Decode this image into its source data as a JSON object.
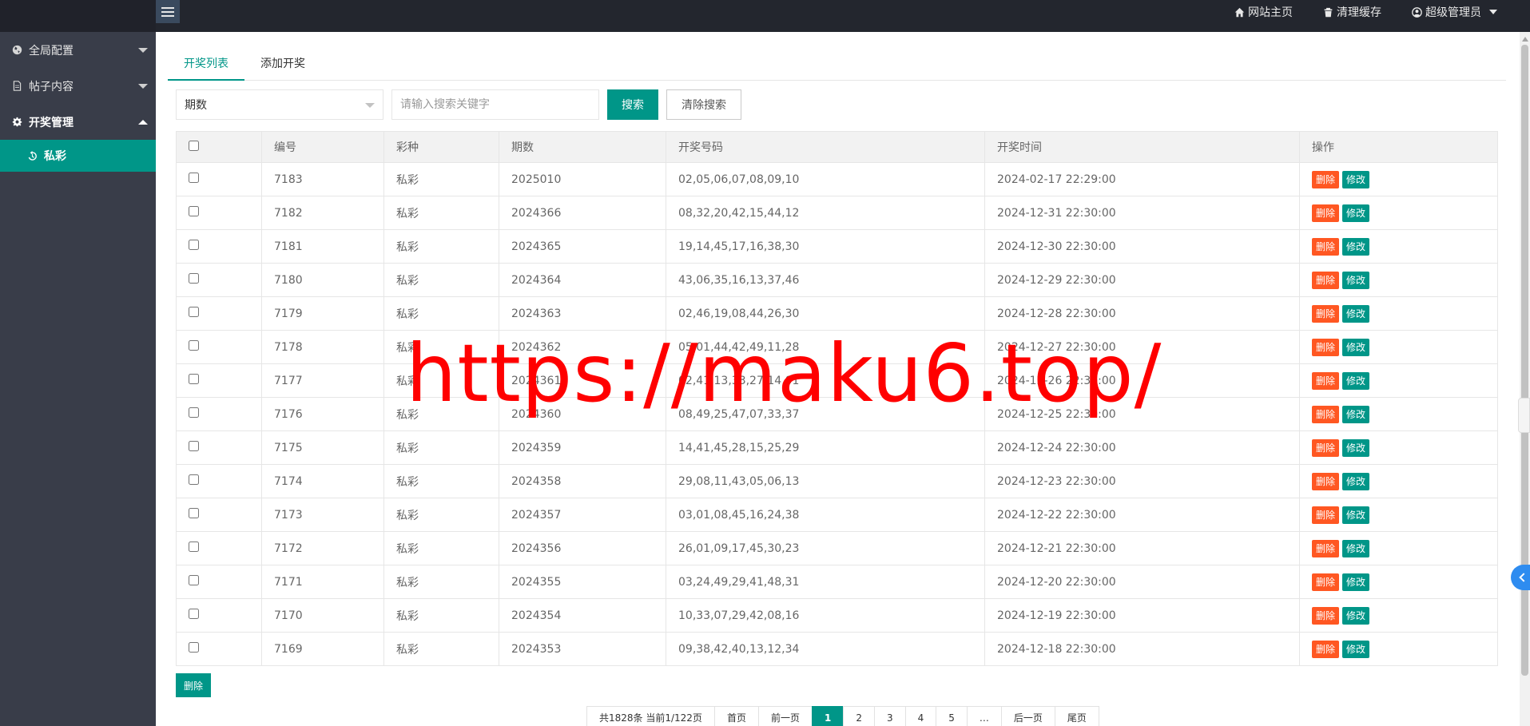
{
  "header": {
    "links": [
      {
        "label": "网站主页",
        "icon": "home-icon"
      },
      {
        "label": "清理缓存",
        "icon": "trash-icon"
      },
      {
        "label": "超级管理员",
        "icon": "user-icon"
      }
    ]
  },
  "sidebar": {
    "items": [
      {
        "label": "全局配置",
        "icon": "globe-icon",
        "expanded": false
      },
      {
        "label": "帖子内容",
        "icon": "document-icon",
        "expanded": false
      },
      {
        "label": "开奖管理",
        "icon": "gear-icon",
        "expanded": true
      }
    ],
    "sub_item": {
      "label": "私彩",
      "icon": "history-icon"
    }
  },
  "tabs": [
    {
      "label": "开奖列表",
      "active": true
    },
    {
      "label": "添加开奖",
      "active": false
    }
  ],
  "search": {
    "field_select": "期数",
    "placeholder": "请输入搜索关键字",
    "search_label": "搜索",
    "clear_label": "清除搜索"
  },
  "table": {
    "columns": [
      "",
      "编号",
      "彩种",
      "期数",
      "开奖号码",
      "开奖时间",
      "操作"
    ],
    "delete_label": "删除",
    "edit_label": "修改",
    "rows": [
      {
        "id": "7183",
        "type": "私彩",
        "period": "2025010",
        "numbers": "02,05,06,07,08,09,10",
        "time": "2024-02-17 22:29:00"
      },
      {
        "id": "7182",
        "type": "私彩",
        "period": "2024366",
        "numbers": "08,32,20,42,15,44,12",
        "time": "2024-12-31 22:30:00"
      },
      {
        "id": "7181",
        "type": "私彩",
        "period": "2024365",
        "numbers": "19,14,45,17,16,38,30",
        "time": "2024-12-30 22:30:00"
      },
      {
        "id": "7180",
        "type": "私彩",
        "period": "2024364",
        "numbers": "43,06,35,16,13,37,46",
        "time": "2024-12-29 22:30:00"
      },
      {
        "id": "7179",
        "type": "私彩",
        "period": "2024363",
        "numbers": "02,46,19,08,44,26,30",
        "time": "2024-12-28 22:30:00"
      },
      {
        "id": "7178",
        "type": "私彩",
        "period": "2024362",
        "numbers": "05,01,44,42,49,11,28",
        "time": "2024-12-27 22:30:00"
      },
      {
        "id": "7177",
        "type": "私彩",
        "period": "2024361",
        "numbers": "02,41,13,33,27,14,01",
        "time": "2024-12-26 22:30:00"
      },
      {
        "id": "7176",
        "type": "私彩",
        "period": "2024360",
        "numbers": "08,49,25,47,07,33,37",
        "time": "2024-12-25 22:30:00"
      },
      {
        "id": "7175",
        "type": "私彩",
        "period": "2024359",
        "numbers": "14,41,45,28,15,25,29",
        "time": "2024-12-24 22:30:00"
      },
      {
        "id": "7174",
        "type": "私彩",
        "period": "2024358",
        "numbers": "29,08,11,43,05,06,13",
        "time": "2024-12-23 22:30:00"
      },
      {
        "id": "7173",
        "type": "私彩",
        "period": "2024357",
        "numbers": "03,01,08,45,16,24,38",
        "time": "2024-12-22 22:30:00"
      },
      {
        "id": "7172",
        "type": "私彩",
        "period": "2024356",
        "numbers": "26,01,09,17,45,30,23",
        "time": "2024-12-21 22:30:00"
      },
      {
        "id": "7171",
        "type": "私彩",
        "period": "2024355",
        "numbers": "03,24,49,29,41,48,31",
        "time": "2024-12-20 22:30:00"
      },
      {
        "id": "7170",
        "type": "私彩",
        "period": "2024354",
        "numbers": "10,33,07,29,42,08,16",
        "time": "2024-12-19 22:30:00"
      },
      {
        "id": "7169",
        "type": "私彩",
        "period": "2024353",
        "numbers": "09,38,42,40,13,12,34",
        "time": "2024-12-18 22:30:00"
      }
    ]
  },
  "bulk_delete_label": "删除",
  "pagination": {
    "summary": "共1828条 当前1/122页",
    "first": "首页",
    "prev": "前一页",
    "pages": [
      "1",
      "2",
      "3",
      "4",
      "5"
    ],
    "current": "1",
    "ellipsis": "…",
    "next": "后一页",
    "last": "尾页"
  },
  "watermark": "https://maku6.top/",
  "colors": {
    "accent": "#009688",
    "danger": "#ff5722",
    "sidebar_bg": "#393d49",
    "header_bg": "#23262e"
  }
}
